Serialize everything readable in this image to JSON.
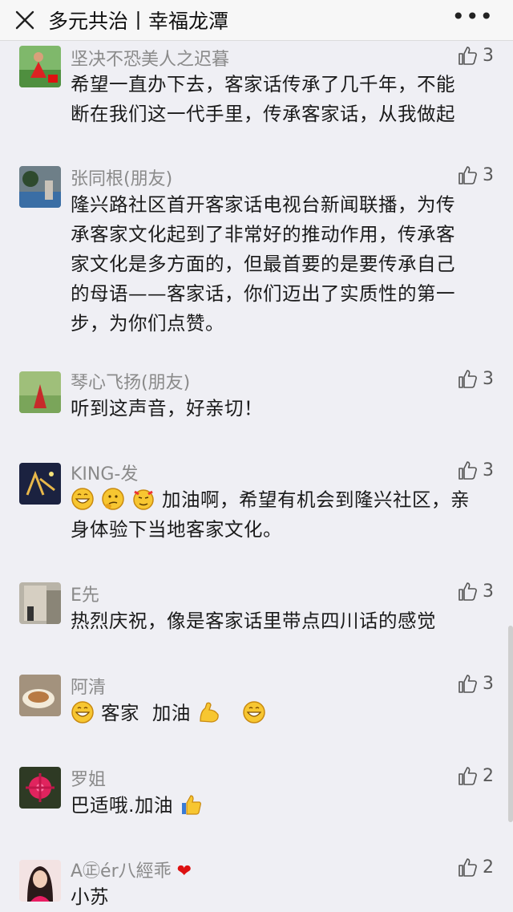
{
  "header": {
    "title": "多元共治丨幸福龙潭",
    "close_icon": "close-icon",
    "more_icon": "more-icon",
    "more_glyph": "•••"
  },
  "comments": [
    {
      "name": "坚决不恐美人之迟暮",
      "likes": "3",
      "lines": [
        "希望一直办下去，客家话传承了几千年，不能",
        "断在我们这一代手里，传承客家话，从我做起"
      ]
    },
    {
      "name": "张同根(朋友)",
      "likes": "3",
      "lines": [
        "隆兴路社区首开客家话电视台新闻联播，为传",
        "承客家文化起到了非常好的推动作用，传承客",
        "家文化是多方面的，但最首要的是要传承自己",
        "的母语——客家话，你们迈出了实质性的第一",
        "步，为你们点赞。"
      ]
    },
    {
      "name": "琴心飞扬(朋友)",
      "likes": "3",
      "lines": [
        "听到这声音，好亲切！"
      ]
    },
    {
      "name": "KING-发",
      "likes": "3",
      "lines": [
        "加油啊，希望有机会到隆兴社区，亲",
        "身体验下当地客家文化。"
      ]
    },
    {
      "name": "E先",
      "likes": "3",
      "lines": [
        "热烈庆祝，像是客家话里带点四川话的感觉"
      ]
    },
    {
      "name": "阿清",
      "likes": "3",
      "lines": [
        "客家  加油"
      ]
    },
    {
      "name": "罗姐",
      "likes": "2",
      "lines": [
        "巴适哦.加油"
      ]
    },
    {
      "name": "A㊣ér八經乖",
      "likes": "2",
      "lines": [
        "小苏"
      ]
    }
  ],
  "icons": {
    "like": "thumbs-up-icon"
  }
}
